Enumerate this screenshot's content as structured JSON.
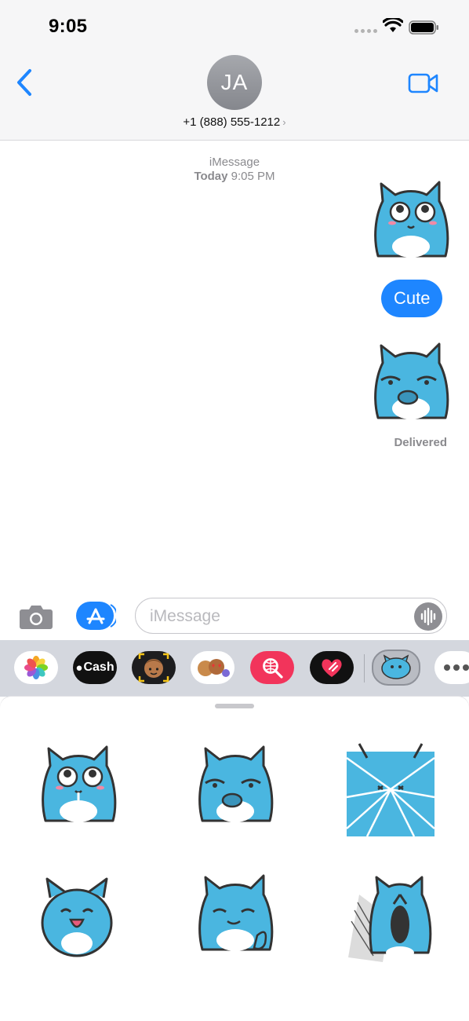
{
  "status_bar": {
    "time": "9:05"
  },
  "header": {
    "avatar_initials": "JA",
    "contact": "+1 (888) 555-1212",
    "chevron": "›"
  },
  "conversation": {
    "service": "iMessage",
    "date_prefix": "Today",
    "time": "9:05 PM",
    "bubble_text": "Cute",
    "delivered": "Delivered"
  },
  "composer": {
    "placeholder": "iMessage"
  },
  "app_strip": {
    "items": [
      {
        "name": "photos-app-icon"
      },
      {
        "name": "apple-cash-app-icon",
        "label": "Cash"
      },
      {
        "name": "memoji-app-icon"
      },
      {
        "name": "memoji-stickers-app-icon"
      },
      {
        "name": "web-search-app-icon"
      },
      {
        "name": "digital-touch-app-icon"
      },
      {
        "name": "sticker-pack-app-icon"
      },
      {
        "name": "more-apps-icon"
      }
    ]
  },
  "colors": {
    "accent_blue": "#1e86ff",
    "sticker_blue": "#4ab6e0",
    "cash_black": "#111111",
    "search_pink": "#f2345b"
  }
}
